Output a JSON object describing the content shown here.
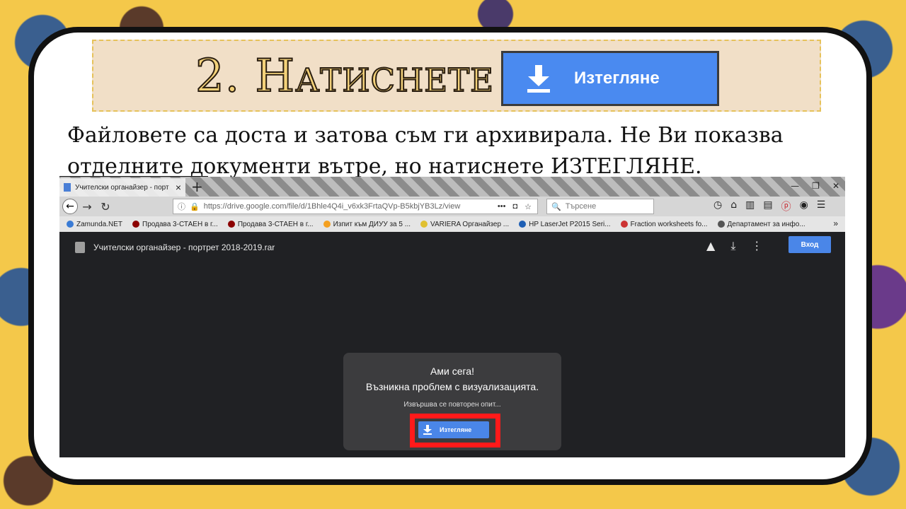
{
  "title": {
    "heading": "2. Натиснете",
    "button_label": "Изтегляне",
    "button_icon": "download-icon"
  },
  "description": "Файловете са доста и затова съм ги архивирала. Не Ви показва отделните документи вътре, но натиснете ИЗТЕГЛЯНЕ.",
  "browser": {
    "tab": {
      "label": "Учителски органайзер - порт",
      "close": "×"
    },
    "new_tab": "+",
    "url": "https://drive.google.com/file/d/1Bhle4Q4i_v6xk3FrtaQVp-B5kbjYB3Lz/view",
    "search_placeholder": "Търсене",
    "bookmarks": [
      {
        "label": "Zamunda.NET",
        "color": "#3a7bd5"
      },
      {
        "label": "Продава 3-СТАЕН в г...",
        "color": "#8b0000"
      },
      {
        "label": "Продава 3-СТАЕН в г...",
        "color": "#8b0000"
      },
      {
        "label": "Изпит към ДИУУ за 5 ...",
        "color": "#f4a020"
      },
      {
        "label": "VARIERA Органайзер ...",
        "color": "#e0c030"
      },
      {
        "label": "HP LaserJet P2015 Seri...",
        "color": "#1e5fb4"
      },
      {
        "label": "Fraction worksheets fo...",
        "color": "#cc3333"
      },
      {
        "label": "Департамент за инфо...",
        "color": "#555555"
      }
    ]
  },
  "drive": {
    "file_name": "Учителски органайзер - портрет 2018-2019.rar",
    "login": "Вход",
    "error_title": "Ами сега!",
    "error_message": "Възникна проблем с визуализацията.",
    "retry_text": "Извършва се повторен опит...",
    "download_label": "Изтегляне"
  }
}
